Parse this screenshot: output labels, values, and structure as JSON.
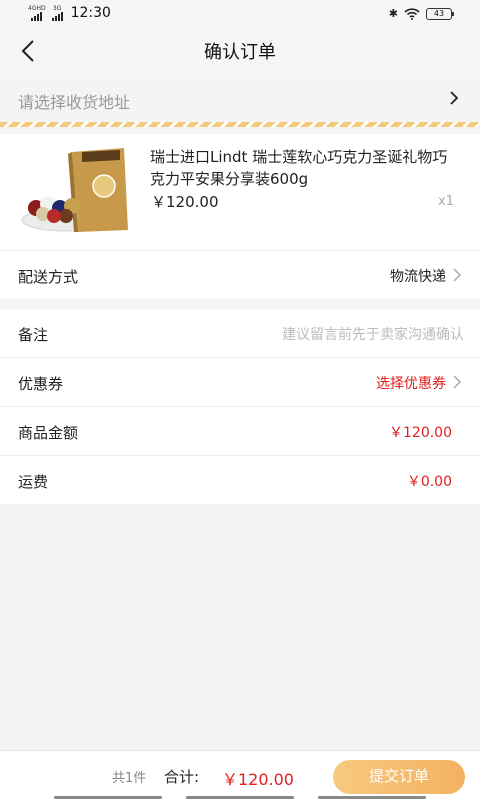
{
  "status_bar": {
    "signal1_label": "4GHD",
    "signal2_label": "3G",
    "time": "12:30",
    "battery": "43"
  },
  "header": {
    "title": "确认订单"
  },
  "address": {
    "placeholder": "请选择收货地址"
  },
  "product": {
    "name": "瑞士进口Lindt 瑞士莲软心巧克力圣诞礼物巧克力平安果分享装600g",
    "price": "￥120.00",
    "quantity": "x1"
  },
  "delivery": {
    "label": "配送方式",
    "value": "物流快递"
  },
  "remark": {
    "label": "备注",
    "placeholder": "建议留言前先于卖家沟通确认"
  },
  "coupon": {
    "label": "优惠券",
    "value": "选择优惠券"
  },
  "goods_amount": {
    "label": "商品金额",
    "value": "￥120.00"
  },
  "shipping": {
    "label": "运费",
    "value": "￥0.00"
  },
  "footer": {
    "count": "共1件",
    "total_label": "合计:",
    "total_value": "￥120.00",
    "submit_label": "提交订单"
  },
  "colors": {
    "accent": "#f3b262",
    "price_red": "#e02020",
    "stripe": "#f3c97b"
  }
}
